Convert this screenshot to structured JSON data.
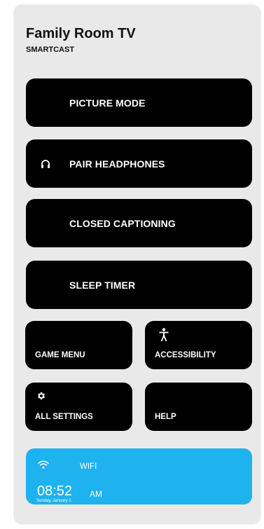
{
  "header": {
    "title": "Family Room TV",
    "subtitle": "SMARTCAST"
  },
  "menu": {
    "picture_mode": "PICTURE MODE",
    "pair_headphones": "PAIR HEADPHONES",
    "closed_captioning": "CLOSED CAPTIONING",
    "sleep_timer": "SLEEP TIMER",
    "game_menu": "GAME MENU",
    "accessibility": "ACCESSIBILITY",
    "all_settings": "ALL SETTINGS",
    "help": "HELP"
  },
  "status": {
    "wifi_label": "WIFI",
    "time": "08:52",
    "ampm": "AM",
    "date": "Sunday, January 1"
  },
  "icons": {
    "pair_headphones": "headphones-icon",
    "accessibility": "accessibility-person-icon",
    "all_settings": "gear-icon",
    "status": "wifi-icon"
  },
  "colors": {
    "panel_background": "#e9e9e9",
    "button_background": "#000000",
    "button_text": "#ffffff",
    "status_card": "#1eb2ef"
  }
}
